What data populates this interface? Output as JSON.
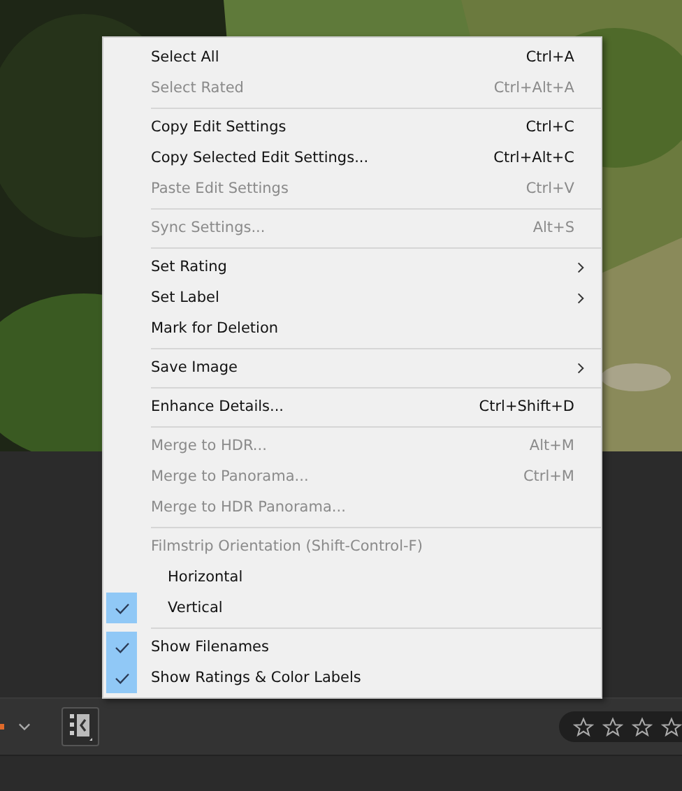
{
  "menu": {
    "items": [
      {
        "kind": "item",
        "label": "Select All",
        "shortcut": "Ctrl+A",
        "disabled": false,
        "checked": false,
        "submenu": false
      },
      {
        "kind": "item",
        "label": "Select Rated",
        "shortcut": "Ctrl+Alt+A",
        "disabled": true,
        "checked": false,
        "submenu": false
      },
      {
        "kind": "separator"
      },
      {
        "kind": "item",
        "label": "Copy Edit Settings",
        "shortcut": "Ctrl+C",
        "disabled": false,
        "checked": false,
        "submenu": false
      },
      {
        "kind": "item",
        "label": "Copy Selected Edit Settings...",
        "shortcut": "Ctrl+Alt+C",
        "disabled": false,
        "checked": false,
        "submenu": false
      },
      {
        "kind": "item",
        "label": "Paste Edit Settings",
        "shortcut": "Ctrl+V",
        "disabled": true,
        "checked": false,
        "submenu": false
      },
      {
        "kind": "separator"
      },
      {
        "kind": "item",
        "label": "Sync Settings...",
        "shortcut": "Alt+S",
        "disabled": true,
        "checked": false,
        "submenu": false
      },
      {
        "kind": "separator"
      },
      {
        "kind": "item",
        "label": "Set Rating",
        "disabled": false,
        "checked": false,
        "submenu": true
      },
      {
        "kind": "item",
        "label": "Set Label",
        "disabled": false,
        "checked": false,
        "submenu": true
      },
      {
        "kind": "item",
        "label": "Mark for Deletion",
        "disabled": false,
        "checked": false,
        "submenu": false
      },
      {
        "kind": "separator"
      },
      {
        "kind": "item",
        "label": "Save Image",
        "disabled": false,
        "checked": false,
        "submenu": true
      },
      {
        "kind": "separator"
      },
      {
        "kind": "item",
        "label": "Enhance Details...",
        "shortcut": "Ctrl+Shift+D",
        "disabled": false,
        "checked": false,
        "submenu": false
      },
      {
        "kind": "separator"
      },
      {
        "kind": "item",
        "label": "Merge to HDR...",
        "shortcut": "Alt+M",
        "disabled": true,
        "checked": false,
        "submenu": false
      },
      {
        "kind": "item",
        "label": "Merge to Panorama...",
        "shortcut": "Ctrl+M",
        "disabled": true,
        "checked": false,
        "submenu": false
      },
      {
        "kind": "item",
        "label": "Merge to HDR Panorama...",
        "disabled": true,
        "checked": false,
        "submenu": false
      },
      {
        "kind": "separator"
      },
      {
        "kind": "header",
        "label": "Filmstrip Orientation (Shift-Control-F)"
      },
      {
        "kind": "option",
        "label": "Horizontal",
        "disabled": false,
        "checked": false,
        "submenu": false
      },
      {
        "kind": "option",
        "label": "Vertical",
        "disabled": false,
        "checked": true,
        "submenu": false
      },
      {
        "kind": "separator"
      },
      {
        "kind": "item",
        "label": "Show Filenames",
        "disabled": false,
        "checked": true,
        "submenu": false
      },
      {
        "kind": "item",
        "label": "Show Ratings & Color Labels",
        "disabled": false,
        "checked": true,
        "submenu": false
      }
    ]
  },
  "toolbar": {
    "rating": {
      "stars": 0
    }
  }
}
